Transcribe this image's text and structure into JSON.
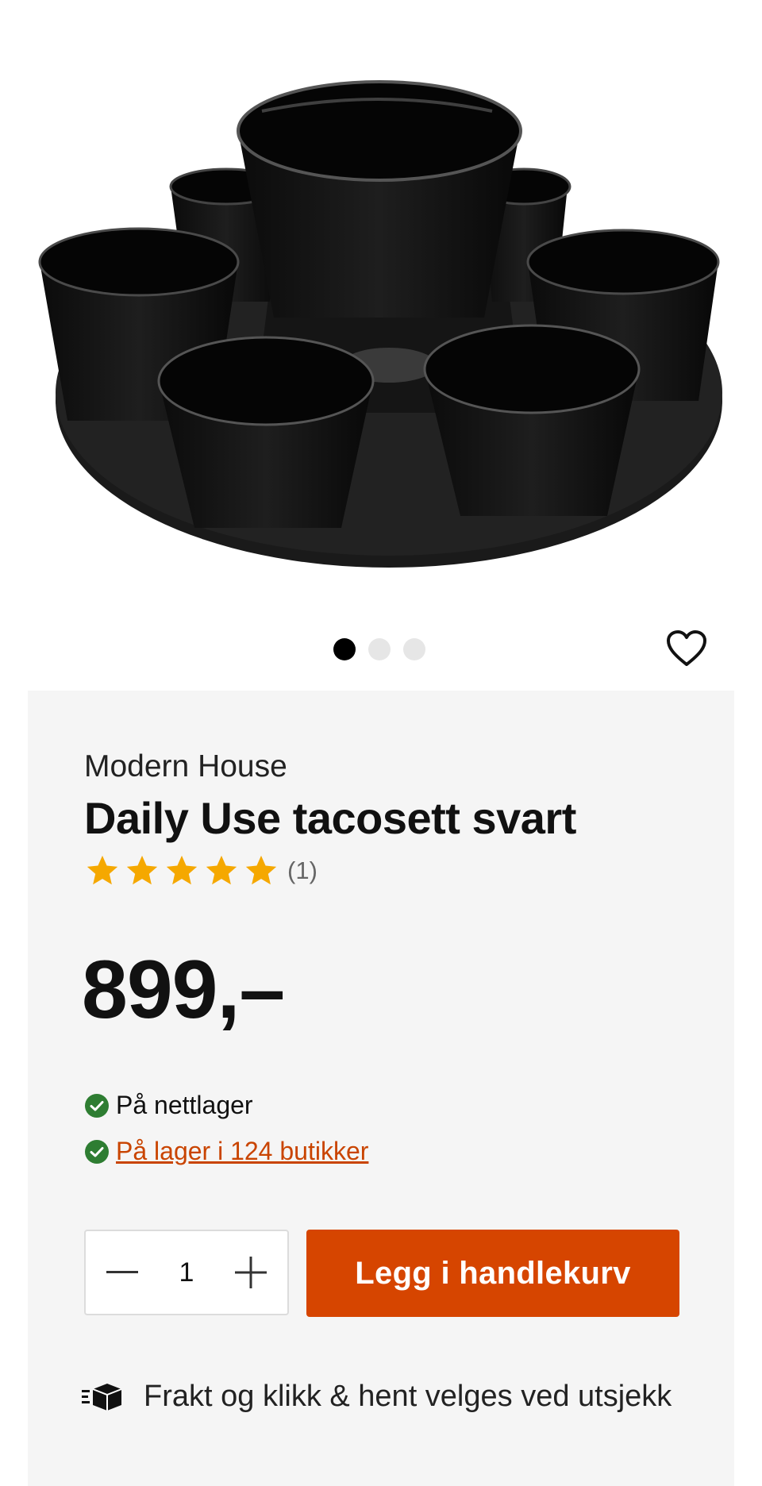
{
  "product": {
    "brand": "Modern House",
    "title": "Daily Use tacosett svart",
    "rating_count": "(1)",
    "rating_value": 5,
    "rating_max": 5,
    "price": "899,–"
  },
  "gallery": {
    "image_alt": "Daily Use tacosett svart",
    "image_count": 3,
    "active_index": 0
  },
  "stock": {
    "online_text": "På nettlager",
    "stores_text": " På lager i 124 butikker"
  },
  "cart": {
    "quantity": "1",
    "add_label": "Legg i handlekurv"
  },
  "shipping": {
    "text": "Frakt og klikk & hent velges ved utsjekk"
  },
  "colors": {
    "accent": "#d64500",
    "link": "#c94400",
    "check": "#2e7d32",
    "star": "#f5a800",
    "panel": "#f5f5f5"
  }
}
